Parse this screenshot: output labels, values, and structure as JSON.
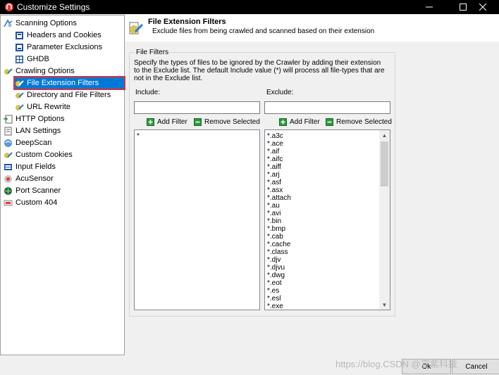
{
  "window": {
    "title": "Customize Settings",
    "minimize_glyph": "—",
    "maximize_glyph": "☐",
    "close_glyph": "✕"
  },
  "tree": {
    "items": [
      {
        "label": "Scanning Options",
        "icon": "scan-options-icon"
      },
      {
        "label": "Headers and Cookies",
        "icon": "headers-icon"
      },
      {
        "label": "Parameter Exclusions",
        "icon": "param-exclusion-icon"
      },
      {
        "label": "GHDB",
        "icon": "ghdb-icon"
      },
      {
        "label": "Crawling Options",
        "icon": "crawl-options-icon"
      },
      {
        "label": "File Extension Filters",
        "icon": "file-filter-icon"
      },
      {
        "label": "Directory and File Filters",
        "icon": "dir-filter-icon"
      },
      {
        "label": "URL Rewrite",
        "icon": "url-rewrite-icon"
      },
      {
        "label": "HTTP Options",
        "icon": "http-options-icon"
      },
      {
        "label": "LAN Settings",
        "icon": "lan-settings-icon"
      },
      {
        "label": "DeepScan",
        "icon": "deepscan-icon"
      },
      {
        "label": "Custom Cookies",
        "icon": "custom-cookies-icon"
      },
      {
        "label": "Input Fields",
        "icon": "input-fields-icon"
      },
      {
        "label": "AcuSensor",
        "icon": "acusensor-icon"
      },
      {
        "label": "Port Scanner",
        "icon": "port-scanner-icon"
      },
      {
        "label": "Custom 404",
        "icon": "custom-404-icon"
      }
    ],
    "selected_index": 5
  },
  "header": {
    "title": "File Extension Filters",
    "subtitle": "Exclude files from being crawled and scanned based on their extension"
  },
  "group": {
    "title": "File Filters",
    "description": "Specify the types of files to be ignored by the Crawler by adding their extension to the Exclude list. The default Include value (*) will process all file-types that are not in the Exclude list."
  },
  "include": {
    "label": "Include:",
    "input_value": "",
    "add_label": "Add Filter",
    "remove_label": "Remove Selected",
    "items": [
      "*"
    ]
  },
  "exclude": {
    "label": "Exclude:",
    "input_value": "",
    "add_label": "Add Filter",
    "remove_label": "Remove Selected",
    "items": [
      "*.a3c",
      "*.ace",
      "*.aif",
      "*.aifc",
      "*.aiff",
      "*.arj",
      "*.asf",
      "*.asx",
      "*.attach",
      "*.au",
      "*.avi",
      "*.bin",
      "*.bmp",
      "*.cab",
      "*.cache",
      "*.class",
      "*.djv",
      "*.djvu",
      "*.dwg",
      "*.eot",
      "*.es",
      "*.esl",
      "*.exe"
    ]
  },
  "footer": {
    "ok_label": "Ok",
    "cancel_label": "Cancel",
    "watermark": "https://blog.CSDN @宣紫科技"
  },
  "colors": {
    "selection": "#0078d7",
    "highlight_border": "#e0323a",
    "titlebar": "#000000"
  }
}
